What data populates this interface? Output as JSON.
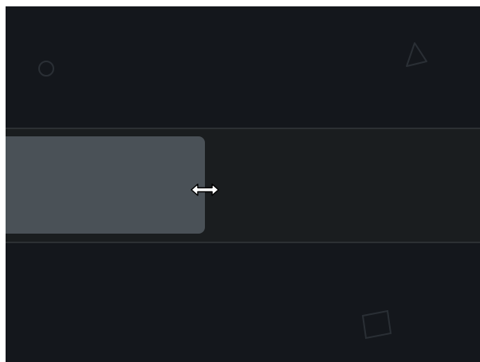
{
  "scene": {
    "background_color": "#14171c",
    "strip_color": "#1a1d1f",
    "strip_border_color": "#2c3033",
    "panel_color": "#4a5157",
    "decorative_shapes": [
      {
        "name": "circle-outline"
      },
      {
        "name": "triangle-outline"
      },
      {
        "name": "square-outline"
      }
    ]
  },
  "slider": {
    "fill_fraction": 0.42
  },
  "cursor": {
    "icon": "horizontal-resize-cursor"
  }
}
